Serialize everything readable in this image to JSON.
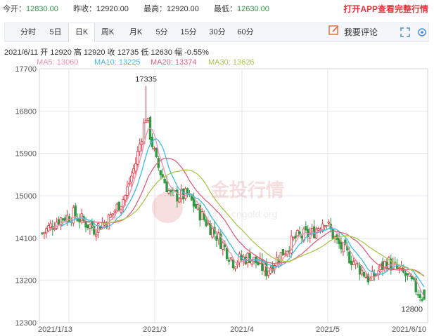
{
  "quote": {
    "open_label": "今开：",
    "open_value": "12830.00",
    "prev_label": "昨收：",
    "prev_value": "12920.00",
    "high_label": "最高：",
    "high_value": "12920.00",
    "low_label": "最低：",
    "low_value": "12630.00",
    "cta": "打开APP查看完整行情"
  },
  "tabs": [
    "分时",
    "5日",
    "日K",
    "周K",
    "月K",
    "5分",
    "15分",
    "30分",
    "60分"
  ],
  "active_tab": "日K",
  "toolbar": {
    "comment_label": "我要评论"
  },
  "info_line": "2021/6/11  开 12920  高 12920  收 12735  低 12630  幅 -0.55%",
  "ma_legend": [
    {
      "label": "MA5: 13060",
      "color": "#f08fb2"
    },
    {
      "label": "MA10: 13225",
      "color": "#3cbde6"
    },
    {
      "label": "MA20: 13374",
      "color": "#e0607e"
    },
    {
      "label": "MA30: 13626",
      "color": "#a8c84a"
    }
  ],
  "colors": {
    "up": "#e8323c",
    "down": "#2e9a44",
    "grid": "#e3e6ec",
    "axis_text": "#555555"
  },
  "watermark": {
    "text": "金投行情",
    "sub": "quote.cngold.org"
  },
  "chart_data": {
    "type": "candlestick",
    "y_ticks": [
      "17700",
      "16800",
      "15900",
      "15000",
      "14100",
      "13200",
      "12300"
    ],
    "ylim": [
      12300,
      17700
    ],
    "x_tick_labels": [
      "2021/1/13",
      "2021/3",
      "2021/4",
      "2021/5",
      "2021/6/10"
    ],
    "annotations": {
      "max_label": "17335",
      "min_label": "12800"
    },
    "approx_ohlc_samples": [
      {
        "date": "2021/1/13",
        "close": 14200
      },
      {
        "date": "2021/2",
        "close": 14400
      },
      {
        "date": "2021/3",
        "close": 16700
      },
      {
        "date": "2021/4",
        "close": 14900
      },
      {
        "date": "2021/4",
        "close": 13700
      },
      {
        "date": "2021/5",
        "close": 14200
      },
      {
        "date": "2021/6/10",
        "close": 12800
      }
    ],
    "series": [
      {
        "name": "MA5: 13060",
        "color": "#f08fb2"
      },
      {
        "name": "MA10: 13225",
        "color": "#3cbde6"
      },
      {
        "name": "MA20: 13374",
        "color": "#e0607e"
      },
      {
        "name": "MA30: 13626",
        "color": "#a8c84a"
      }
    ]
  }
}
